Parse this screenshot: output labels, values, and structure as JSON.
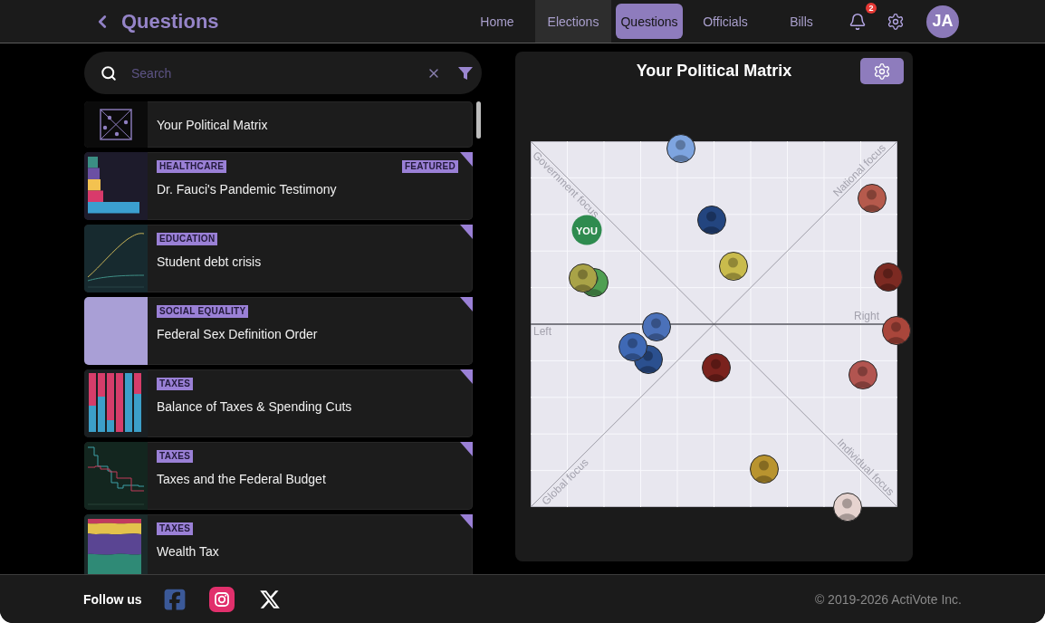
{
  "header": {
    "title": "Questions"
  },
  "nav": [
    {
      "label": "Home",
      "selected": false,
      "hovered": false
    },
    {
      "label": "Elections",
      "selected": false,
      "hovered": true
    },
    {
      "label": "Questions",
      "selected": true,
      "hovered": false
    },
    {
      "label": "Officials",
      "selected": false,
      "hovered": false
    },
    {
      "label": "Bills",
      "selected": false,
      "hovered": false
    }
  ],
  "notifications": {
    "badge": "2"
  },
  "user": {
    "initials": "JA"
  },
  "search": {
    "placeholder": "Search"
  },
  "questions": [
    {
      "kind": "matrix",
      "title": "Your Political Matrix"
    },
    {
      "kind": "question",
      "thumbnail": {
        "kind": "hbars"
      },
      "tag": "HEALTHCARE",
      "featured": "FEATURED",
      "title": "Dr. Fauci's Pandemic Testimony"
    },
    {
      "kind": "question",
      "thumbnail": {
        "kind": "lines"
      },
      "tag": "EDUCATION",
      "title": "Student debt crisis"
    },
    {
      "kind": "question",
      "thumbnail": {
        "kind": "image"
      },
      "tag": "SOCIAL EQUALITY",
      "title": "Federal Sex Definition Order"
    },
    {
      "kind": "question",
      "thumbnail": {
        "kind": "stacked_bars"
      },
      "tag": "TAXES",
      "title": "Balance of Taxes & Spending Cuts"
    },
    {
      "kind": "question",
      "thumbnail": {
        "kind": "steps"
      },
      "tag": "TAXES",
      "title": "Taxes and the Federal Budget"
    },
    {
      "kind": "question",
      "thumbnail": {
        "kind": "areas"
      },
      "tag": "TAXES",
      "title": "Wealth Tax"
    }
  ],
  "matrix": {
    "title": "Your Political Matrix",
    "labels": {
      "top_left": "Government focus",
      "top_right": "National focus",
      "left": "Left",
      "right": "Right",
      "bottom_left": "Global focus",
      "bottom_right": "Individual focus"
    },
    "you": {
      "label": "YOU"
    },
    "markers": [
      {
        "color": "#7ea5e0"
      },
      {
        "color": "#b55a4c"
      },
      {
        "color": "#23457f"
      },
      {
        "color": "#c9bb4c"
      },
      {
        "color": "#4f9f52"
      },
      {
        "color": "#a9a347"
      },
      {
        "color": "#7c2a22"
      },
      {
        "color": "#4b71b9"
      },
      {
        "color": "#a9463b"
      },
      {
        "color": "#2b508f"
      },
      {
        "color": "#3f69b5"
      },
      {
        "color": "#7a221d"
      },
      {
        "color": "#b25550"
      },
      {
        "color": "#b9942f"
      },
      {
        "color": "#e6d3cf"
      }
    ]
  },
  "footer": {
    "follow_label": "Follow us",
    "copyright": "© 2019-2026 ActiVote Inc."
  }
}
